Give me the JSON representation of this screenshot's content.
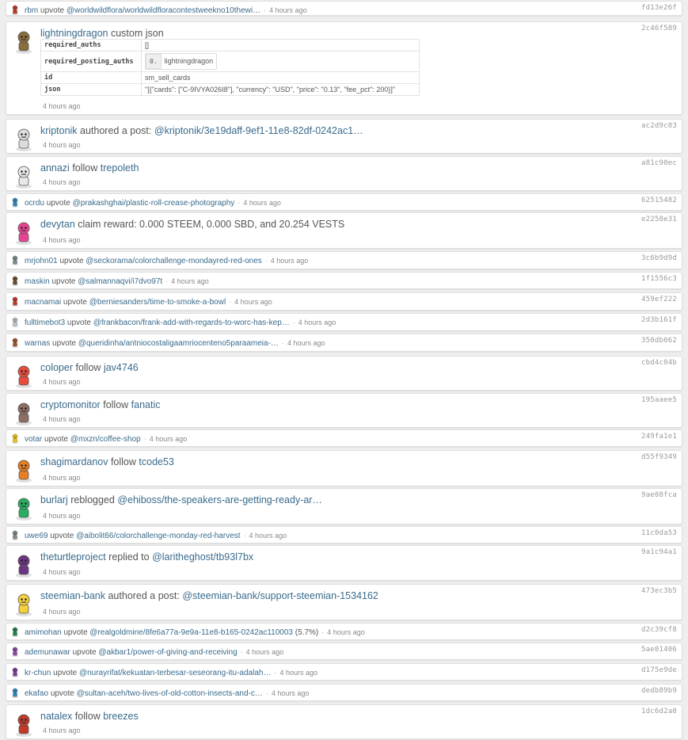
{
  "ops": [
    {
      "size": "small",
      "user": "rbm",
      "verb": "upvote",
      "target": "@worldwildflora/worldwildfloracontestweekno10thewi…",
      "tail": "",
      "time": "4 hours ago",
      "hash": "fd13e26f",
      "avatar_color": "#c0392b"
    },
    {
      "size": "big",
      "type": "custom_json",
      "user": "lightningdragon",
      "verb": "custom json",
      "time": "4 hours ago",
      "hash": "2c46f589",
      "avatar_color": "#8a6d3b",
      "json_table": {
        "required_auths_label": "required_auths",
        "required_auths": "[]",
        "required_posting_auths_label": "required_posting_auths",
        "posting_index": "0.",
        "posting_user": "lightningdragon",
        "id_label": "id",
        "id": "sm_sell_cards",
        "json_label": "json",
        "json": "\"[{\"cards\": [\"C-9IVYA026I8\"], \"currency\": \"USD\", \"price\": \"0.13\", \"fee_pct\": 200}]\""
      }
    },
    {
      "size": "big",
      "user": "kriptonik",
      "verb": "authored a post:",
      "target": "@kriptonik/3e19daff-9ef1-11e8-82df-0242ac1…",
      "tail": "",
      "time": "4 hours ago",
      "hash": "ac2d9c03",
      "avatar_color": "#dddddd"
    },
    {
      "size": "big",
      "user": "annazi",
      "verb": "follow",
      "target": "trepoleth",
      "tail": "",
      "time": "4 hours ago",
      "hash": "a81c90ec",
      "avatar_color": "#e8e8e8"
    },
    {
      "size": "small",
      "user": "ocrdu",
      "verb": "upvote",
      "target": "@prakashghai/plastic-roll-crease-photography",
      "tail": "",
      "time": "4 hours ago",
      "hash": "62515482",
      "avatar_color": "#2e86c1"
    },
    {
      "size": "big",
      "user": "devytan",
      "verb": "claim reward: 0.000 STEEM, 0.000 SBD, and 20.254 VESTS",
      "target": "",
      "tail": "",
      "time": "4 hours ago",
      "hash": "e2258e31",
      "avatar_color": "#e84393"
    },
    {
      "size": "small",
      "user": "mrjohn01",
      "verb": "upvote",
      "target": "@seckorama/colorchallenge-mondayred-red-ones",
      "tail": "",
      "time": "4 hours ago",
      "hash": "3c6b9d9d",
      "avatar_color": "#7f8c8d"
    },
    {
      "size": "small",
      "user": "maskin",
      "verb": "upvote",
      "target": "@salmannaqvi/i7dvo97t",
      "tail": "",
      "time": "4 hours ago",
      "hash": "1f1556c3",
      "avatar_color": "#6e4b2a"
    },
    {
      "size": "small",
      "user": "macnamai",
      "verb": "upvote",
      "target": "@berniesanders/time-to-smoke-a-bowl",
      "tail": "",
      "time": "4 hours ago",
      "hash": "459ef222",
      "avatar_color": "#c0392b"
    },
    {
      "size": "small",
      "user": "fulltimebot3",
      "verb": "upvote",
      "target": "@frankbacon/frank-add-with-regards-to-worc-has-kep…",
      "tail": "",
      "time": "4 hours ago",
      "hash": "2d3b161f",
      "avatar_color": "#bdc3c7"
    },
    {
      "size": "small",
      "user": "warnas",
      "verb": "upvote",
      "target": "@queridinha/antniocostaligaamriocenteno5paraameia-…",
      "tail": "",
      "time": "4 hours ago",
      "hash": "350db062",
      "avatar_color": "#a0522d"
    },
    {
      "size": "big",
      "user": "coloper",
      "verb": "follow",
      "target": "jav4746",
      "tail": "",
      "time": "4 hours ago",
      "hash": "cbd4c04b",
      "avatar_color": "#e74c3c"
    },
    {
      "size": "big",
      "user": "cryptomonitor",
      "verb": "follow",
      "target": "fanatic",
      "tail": "",
      "time": "4 hours ago",
      "hash": "195aaee5",
      "avatar_color": "#8d6e63"
    },
    {
      "size": "small",
      "user": "votar",
      "verb": "upvote",
      "target": "@mxzn/coffee-shop",
      "tail": "",
      "time": "4 hours ago",
      "hash": "249fa1e1",
      "avatar_color": "#f1c40f"
    },
    {
      "size": "big",
      "user": "shagimardanov",
      "verb": "follow",
      "target": "tcode53",
      "tail": "",
      "time": "4 hours ago",
      "hash": "d55f9349",
      "avatar_color": "#e67e22"
    },
    {
      "size": "big",
      "user": "burlarj",
      "verb": "reblogged",
      "target": "@ehiboss/the-speakers-are-getting-ready-ar…",
      "tail": "",
      "time": "4 hours ago",
      "hash": "9ae08fca",
      "avatar_color": "#27ae60"
    },
    {
      "size": "small",
      "user": "uwe69",
      "verb": "upvote",
      "target": "@aibolit66/colorchallenge-monday-red-harvest",
      "tail": "",
      "time": "4 hours ago",
      "hash": "11c0da53",
      "avatar_color": "#7f8c8d"
    },
    {
      "size": "big",
      "user": "theturtleproject",
      "verb": "replied to",
      "target": "@laritheghost/tb93l7bx",
      "tail": "",
      "time": "4 hours ago",
      "hash": "9a1c94a1",
      "avatar_color": "#6c3483"
    },
    {
      "size": "big",
      "user": "steemian-bank",
      "verb": "authored a post:",
      "target": "@steemian-bank/support-steemian-1534162",
      "tail": "",
      "time": "4 hours ago",
      "hash": "473ec3b5",
      "avatar_color": "#f4d03f"
    },
    {
      "size": "small",
      "user": "amimohan",
      "verb": "upvote",
      "target": "@realgoldmine/8fe6a77a-9e9a-11e8-b165-0242ac110003",
      "tail": "(5.7%)",
      "time": "4 hours ago",
      "hash": "d2c39cf8",
      "avatar_color": "#1e8449"
    },
    {
      "size": "small",
      "user": "ademunawar",
      "verb": "upvote",
      "target": "@akbar1/power-of-giving-and-receiving",
      "tail": "",
      "time": "4 hours ago",
      "hash": "5ae01406",
      "avatar_color": "#8e44ad"
    },
    {
      "size": "small",
      "user": "kr-chun",
      "verb": "upvote",
      "target": "@nurayrifat/kekuatan-terbesar-seseorang-itu-adalah…",
      "tail": "",
      "time": "4 hours ago",
      "hash": "d175e9de",
      "avatar_color": "#7d3c98"
    },
    {
      "size": "small",
      "user": "ekafao",
      "verb": "upvote",
      "target": "@sultan-aceh/two-lives-of-old-cotton-insects-and-c…",
      "tail": "",
      "time": "4 hours ago",
      "hash": "dedb89b9",
      "avatar_color": "#2e86c1"
    },
    {
      "size": "big",
      "user": "natalex",
      "verb": "follow",
      "target": "breezes",
      "tail": "",
      "time": "4 hours ago",
      "hash": "1dc6d2a0",
      "avatar_color": "#c0392b"
    }
  ]
}
